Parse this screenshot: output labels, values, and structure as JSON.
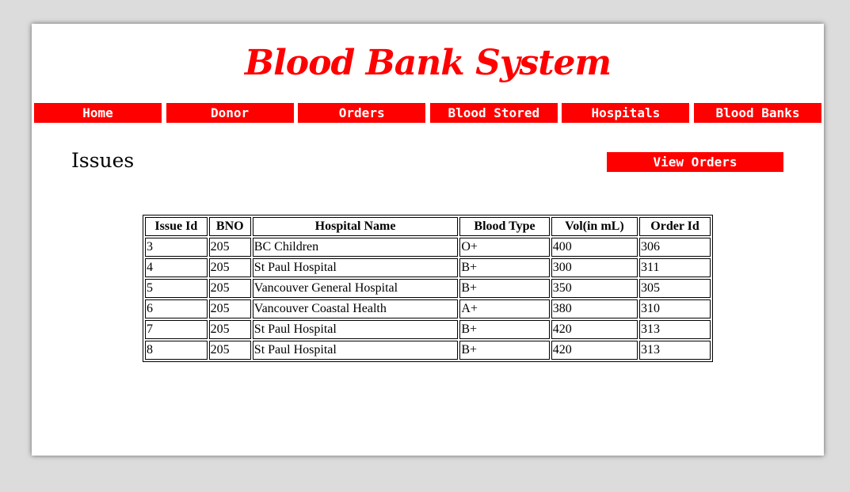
{
  "header": {
    "title": "Blood Bank System"
  },
  "nav": {
    "items": [
      {
        "label": "Home"
      },
      {
        "label": "Donor"
      },
      {
        "label": "Orders"
      },
      {
        "label": "Blood Stored"
      },
      {
        "label": "Hospitals"
      },
      {
        "label": "Blood Banks"
      }
    ]
  },
  "main": {
    "section_title": "Issues",
    "view_orders_label": "View Orders",
    "table": {
      "columns": [
        "Issue Id",
        "BNO",
        "Hospital Name",
        "Blood Type",
        "Vol(in mL)",
        "Order Id"
      ],
      "rows": [
        [
          "3",
          "205",
          "BC Children",
          "O+",
          "400",
          "306"
        ],
        [
          "4",
          "205",
          "St Paul Hospital",
          "B+",
          "300",
          "311"
        ],
        [
          "5",
          "205",
          "Vancouver General Hospital",
          "B+",
          "350",
          "305"
        ],
        [
          "6",
          "205",
          "Vancouver Coastal Health",
          "A+",
          "380",
          "310"
        ],
        [
          "7",
          "205",
          "St Paul Hospital",
          "B+",
          "420",
          "313"
        ],
        [
          "8",
          "205",
          "St Paul Hospital",
          "B+",
          "420",
          "313"
        ]
      ]
    }
  },
  "colors": {
    "accent": "#ff0000",
    "background": "#dcdcdc",
    "page": "#ffffff"
  }
}
